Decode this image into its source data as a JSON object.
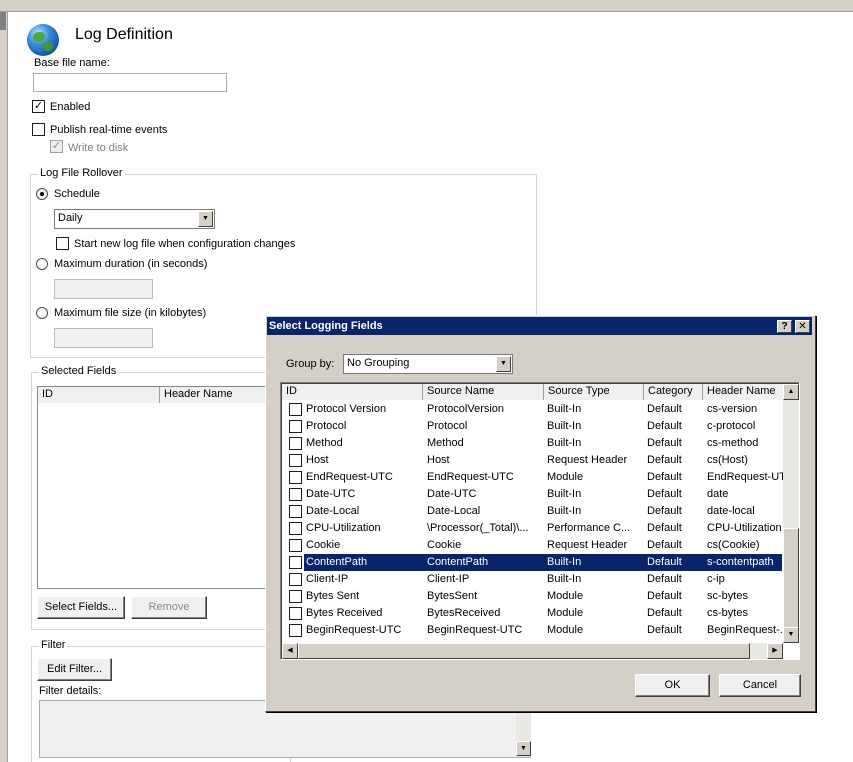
{
  "page": {
    "title": "Log Definition",
    "base_file_name_label": "Base file name:",
    "base_file_name_value": "",
    "enabled_label": "Enabled",
    "enabled_checked": true,
    "publish_label": "Publish real-time events",
    "write_to_disk_label": "Write to disk",
    "write_to_disk_check": "✓",
    "enabled_check": "✓"
  },
  "rollover": {
    "legend": "Log File Rollover",
    "schedule_label": "Schedule",
    "schedule_value": "Daily",
    "start_new_label": "Start new log file when configuration changes",
    "max_duration_label": "Maximum duration (in seconds)",
    "max_size_label": "Maximum file size (in kilobytes)"
  },
  "selected_fields": {
    "legend": "Selected Fields",
    "columns": [
      "ID",
      "Header Name"
    ],
    "select_button": "Select Fields...",
    "remove_button": "Remove"
  },
  "filter": {
    "legend": "Filter",
    "edit_button": "Edit Filter...",
    "details_label": "Filter details:"
  },
  "dialog": {
    "title": "Select Logging Fields",
    "help_label": "?",
    "close_label": "✕",
    "group_by_label": "Group by:",
    "group_by_value": "No Grouping",
    "columns": [
      "ID",
      "Source Name",
      "Source Type",
      "Category",
      "Header Name"
    ],
    "rows": [
      {
        "id": "Protocol Version",
        "source": "ProtocolVersion",
        "type": "Built-In",
        "category": "Default",
        "header": "cs-version"
      },
      {
        "id": "Protocol",
        "source": "Protocol",
        "type": "Built-In",
        "category": "Default",
        "header": "c-protocol"
      },
      {
        "id": "Method",
        "source": "Method",
        "type": "Built-In",
        "category": "Default",
        "header": "cs-method"
      },
      {
        "id": "Host",
        "source": "Host",
        "type": "Request Header",
        "category": "Default",
        "header": "cs(Host)"
      },
      {
        "id": "EndRequest-UTC",
        "source": "EndRequest-UTC",
        "type": "Module",
        "category": "Default",
        "header": "EndRequest-UTC"
      },
      {
        "id": "Date-UTC",
        "source": "Date-UTC",
        "type": "Built-In",
        "category": "Default",
        "header": "date"
      },
      {
        "id": "Date-Local",
        "source": "Date-Local",
        "type": "Built-In",
        "category": "Default",
        "header": "date-local"
      },
      {
        "id": "CPU-Utilization",
        "source": "\\Processor(_Total)\\...",
        "type": "Performance C...",
        "category": "Default",
        "header": "CPU-Utilization"
      },
      {
        "id": "Cookie",
        "source": "Cookie",
        "type": "Request Header",
        "category": "Default",
        "header": "cs(Cookie)"
      },
      {
        "id": "ContentPath",
        "source": "ContentPath",
        "type": "Built-In",
        "category": "Default",
        "header": "s-contentpath",
        "selected": true
      },
      {
        "id": "Client-IP",
        "source": "Client-IP",
        "type": "Built-In",
        "category": "Default",
        "header": "c-ip"
      },
      {
        "id": "Bytes Sent",
        "source": "BytesSent",
        "type": "Module",
        "category": "Default",
        "header": "sc-bytes"
      },
      {
        "id": "Bytes Received",
        "source": "BytesReceived",
        "type": "Module",
        "category": "Default",
        "header": "cs-bytes"
      },
      {
        "id": "BeginRequest-UTC",
        "source": "BeginRequest-UTC",
        "type": "Module",
        "category": "Default",
        "header": "BeginRequest-..."
      }
    ],
    "ok_button": "OK",
    "cancel_button": "Cancel"
  }
}
